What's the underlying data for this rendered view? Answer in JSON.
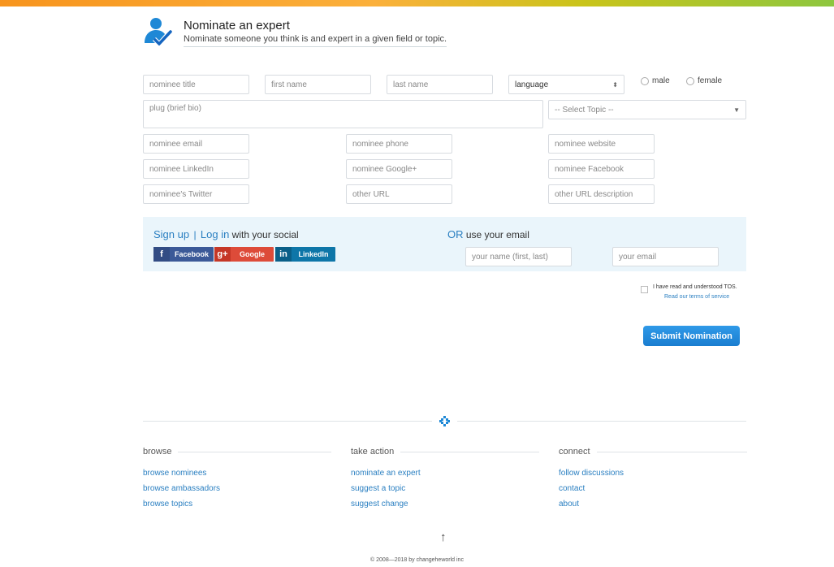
{
  "header": {
    "title": "Nominate an expert",
    "subtitle": "Nominate someone you think is and expert in a given field or topic."
  },
  "form": {
    "nominee_title_placeholder": "nominee title",
    "first_name_placeholder": "first name",
    "last_name_placeholder": "last name",
    "language_label": "language",
    "male_label": "male",
    "female_label": "female",
    "plug_placeholder": "plug (brief bio)",
    "topic_label": "-- Select Topic --",
    "email_placeholder": "nominee email",
    "phone_placeholder": "nominee phone",
    "website_placeholder": "nominee website",
    "linkedin_placeholder": "nominee LinkedIn",
    "google_placeholder": "nominee Google+",
    "facebook_placeholder": "nominee Facebook",
    "twitter_placeholder": "nominee's Twitter",
    "other_url_placeholder": "other URL",
    "other_url_desc_placeholder": "other URL description"
  },
  "social": {
    "signup": "Sign up",
    "separator": "|",
    "login": "Log in",
    "with_social": "with your social",
    "facebook": "Facebook",
    "google": "Google",
    "linkedin": "LinkedIn",
    "or": "OR",
    "use_email": "use your email",
    "name_placeholder": "your name (first, last)",
    "your_email_placeholder": "your email"
  },
  "tos": {
    "text": "I have read and understood TOS.",
    "link": "Read our terms of service"
  },
  "submit_label": "Submit Nomination",
  "footer": {
    "browse": {
      "heading": "browse",
      "links": [
        "browse nominees",
        "browse ambassadors",
        "browse topics"
      ]
    },
    "take_action": {
      "heading": "take action",
      "links": [
        "nominate an expert",
        "suggest a topic",
        "suggest change"
      ]
    },
    "connect": {
      "heading": "connect",
      "links": [
        "follow discussions",
        "contact",
        "about"
      ]
    },
    "arrow": "↑",
    "copyright": "© 2008—2018 by changeheworld inc"
  },
  "colors": {
    "accent": "#2a7fc1",
    "submit": "#1a7dd0",
    "social_box": "#eaf5fb",
    "facebook": "#3b5998",
    "google": "#dd4b39",
    "linkedin": "#0e76a8"
  }
}
